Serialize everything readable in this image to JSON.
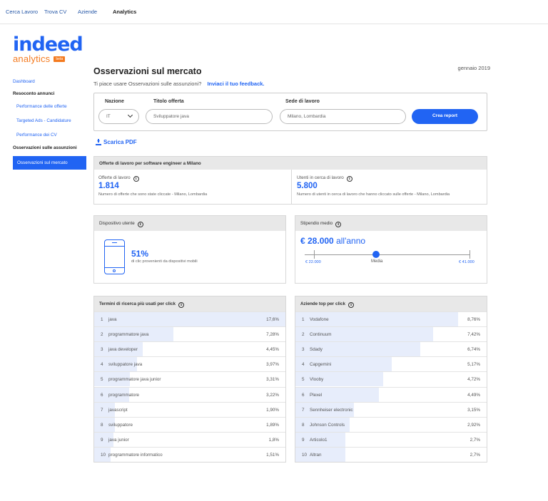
{
  "topnav": [
    {
      "label": "Cerca Lavoro",
      "active": false
    },
    {
      "label": "Trova CV",
      "active": false
    },
    {
      "label": "Aziende",
      "active": false
    },
    {
      "label": "Analytics",
      "active": true
    }
  ],
  "logo": {
    "brand": "indeed",
    "product": "analytics",
    "badge": "beta"
  },
  "sidebar": {
    "dashboard": "Dashboard",
    "section1": "Resoconto annunci",
    "performance_offerte": "Performance delle offerte",
    "targeted_ads": "Targeted Ads - Candidature",
    "performance_cv": "Performance dei CV",
    "section2": "Osservazioni sulle assunzioni",
    "active_item": "Osservazioni sul mercato"
  },
  "header": {
    "title": "Osservazioni sul mercato",
    "date": "gennaio 2019",
    "subtitle": "Ti piace usare Osservazioni sulle assunzioni?",
    "feedback_link": "Inviaci il tuo feedback."
  },
  "form": {
    "nazione_label": "Nazione",
    "nazione_value": "IT",
    "titolo_label": "Titolo offerta",
    "titolo_placeholder": "Sviluppatore java",
    "sede_label": "Sede di lavoro",
    "sede_placeholder": "Milano, Lombardia",
    "submit": "Crea report"
  },
  "download_pdf": "Scarica PDF",
  "offerte_card": {
    "title": "Offerte di lavoro per software engineer a Milano",
    "left": {
      "label": "Offerte di lavoro",
      "value": "1.814",
      "desc": "Numero di offerte che sono state cliccate - Milano, Lombardia"
    },
    "right": {
      "label": "Utenti in cerca di lavoro",
      "value": "5.800",
      "desc": "Numero di utenti in cerca di lavoro che hanno cliccato sulle offerte - Milano, Lombardia"
    }
  },
  "dispositivo": {
    "title": "Dispositivo utente",
    "percent": "51%",
    "desc": "di clic provenienti da dispositivi mobili"
  },
  "stipendio": {
    "title": "Stipendio medio",
    "amount": "€ 28.000",
    "period": "all'anno",
    "min": "€ 22.000",
    "mid": "Media",
    "max": "€ 41.000",
    "position": 0.4
  },
  "termini": {
    "title": "Termini di ricerca più usati per click",
    "rows": [
      {
        "n": "1",
        "term": "java",
        "value": "17,6%",
        "pct": 17.6
      },
      {
        "n": "2",
        "term": "programmatore java",
        "value": "7,28%",
        "pct": 7.28
      },
      {
        "n": "3",
        "term": "java developer",
        "value": "4,45%",
        "pct": 4.45
      },
      {
        "n": "4",
        "term": "sviluppatore java",
        "value": "3,97%",
        "pct": 3.97
      },
      {
        "n": "5",
        "term": "programmatore java junior",
        "value": "3,31%",
        "pct": 3.31
      },
      {
        "n": "6",
        "term": "programmatore",
        "value": "3,22%",
        "pct": 3.22
      },
      {
        "n": "7",
        "term": "javascript",
        "value": "1,90%",
        "pct": 1.9
      },
      {
        "n": "8",
        "term": "sviluppatore",
        "value": "1,89%",
        "pct": 1.89
      },
      {
        "n": "9",
        "term": "java junior",
        "value": "1,8%",
        "pct": 1.8
      },
      {
        "n": "10",
        "term": "programmatore informatico",
        "value": "1,51%",
        "pct": 1.51
      }
    ]
  },
  "aziende": {
    "title": "Aziende top per click",
    "rows": [
      {
        "n": "1",
        "term": "Vodafone",
        "value": "8,76%",
        "pct": 8.76
      },
      {
        "n": "2",
        "term": "Continuum",
        "value": "7,42%",
        "pct": 7.42
      },
      {
        "n": "3",
        "term": "Sdady",
        "value": "6,74%",
        "pct": 6.74
      },
      {
        "n": "4",
        "term": "Capgemini",
        "value": "5,17%",
        "pct": 5.17
      },
      {
        "n": "5",
        "term": "Vlooby",
        "value": "4,72%",
        "pct": 4.72
      },
      {
        "n": "6",
        "term": "Plexel",
        "value": "4,49%",
        "pct": 4.49
      },
      {
        "n": "7",
        "term": "Sennheiser electronic",
        "value": "3,15%",
        "pct": 3.15
      },
      {
        "n": "8",
        "term": "Johnson Controls",
        "value": "2,92%",
        "pct": 2.92
      },
      {
        "n": "9",
        "term": "Articolo1",
        "value": "2,7%",
        "pct": 2.7
      },
      {
        "n": "10",
        "term": "Altran",
        "value": "2,7%",
        "pct": 2.7
      }
    ]
  }
}
